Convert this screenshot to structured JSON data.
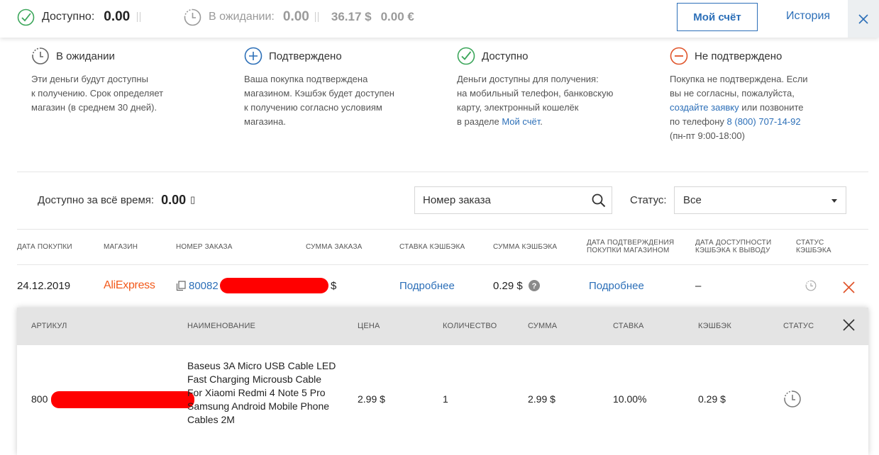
{
  "topbar": {
    "available_label": "Доступно:",
    "available_value": "0.00",
    "pending_label": "В ожидании:",
    "pending_value": "0.00",
    "pending_usd": "36.17 $",
    "pending_eur": "0.00 €",
    "account_button": "Мой счёт",
    "history_link": "История"
  },
  "legend": [
    {
      "icon": "clock-icon",
      "title": "В ожидании",
      "lines": [
        "Эти деньги будут доступны",
        "к получению. Срок определяет",
        "магазин (в среднем 30 дней)."
      ]
    },
    {
      "icon": "plus-circle-icon",
      "title": "Подтверждено",
      "lines": [
        "Ваша покупка подтверждена",
        "магазином. Кэшбэк будет доступен",
        "к получению согласно условиям",
        "магазина."
      ]
    },
    {
      "icon": "check-circle-icon",
      "title": "Доступно",
      "line1": "Деньги доступны для получения:",
      "line2": "на мобильный телефон, банковскую",
      "line3": "карту, электронный кошелёк",
      "line4_pre": "в разделе ",
      "line4_link": "Мой счёт",
      "line4_post": "."
    },
    {
      "icon": "minus-circle-icon",
      "title": "Не подтверждено",
      "line1": "Покупка не подтверждена. Если",
      "line2": "вы не согласны, пожалуйста,",
      "line3_link": "создайте заявку",
      "line3_post": " или позвоните",
      "line4_pre": "по телефону ",
      "line4_link": "8 (800) 707-14-92",
      "line5": "(пн-пт 9:00-18:00)"
    }
  ],
  "filters": {
    "all_time_label": "Доступно за всё время:",
    "all_time_value": "0.00",
    "all_time_currency": "▯",
    "search_placeholder": "Номер заказа",
    "status_label": "Статус:",
    "status_value": "Все"
  },
  "table": {
    "headers": [
      "ДАТА ПОКУПКИ",
      "МАГАЗИН",
      "НОМЕР ЗАКАЗА",
      "СУММА ЗАКАЗА",
      "СТАВКА КЭШБЭКА",
      "СУММА КЭШБЭКА",
      "ДАТА ПОДТВЕРЖДЕНИЯ",
      "ПОКУПКИ МАГАЗИНОМ",
      "ДАТА ДОСТУПНОСТИ",
      "КЭШБЭКА К ВЫВОДУ",
      "СТАТУС",
      "КЭШБЭКА"
    ],
    "row": {
      "date": "24.12.2019",
      "shop": "AliExpress",
      "order_prefix": "80082",
      "order_amount_suffix": "$",
      "rate_link": "Подробнее",
      "cashback": "0.29 $",
      "confirm_date_link": "Подробнее",
      "available_date": "–"
    }
  },
  "detail": {
    "headers": [
      "АРТИКУЛ",
      "НАИМЕНОВАНИЕ",
      "ЦЕНА",
      "КОЛИЧЕСТВО",
      "СУММА",
      "СТАВКА",
      "КЭШБЭК",
      "СТАТУС"
    ],
    "row": {
      "article_prefix": "800",
      "name": "Baseus 3A Micro USB Cable LED Fast Charging Microusb Cable For Xiaomi Redmi 4 Note 5 Pro Samsung Android Mobile Phone Cables 2M",
      "price": "2.99 $",
      "qty": "1",
      "sum": "2.99 $",
      "rate": "10.00%",
      "cashback": "0.29 $"
    }
  },
  "colors": {
    "accent": "#2c6fb8",
    "check": "#3ba65a",
    "minus": "#e0542a",
    "shop": "#f25a1c",
    "redact": "#ff0000"
  }
}
